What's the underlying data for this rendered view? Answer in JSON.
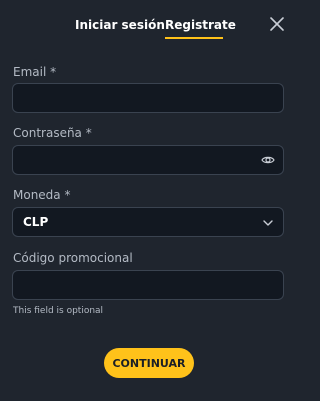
{
  "tabs": {
    "login_label": "Iniciar sesión",
    "register_label": "Registrate",
    "active": "register"
  },
  "colors": {
    "accent": "#ffc21a",
    "background": "#1f252e",
    "field_background": "#121821",
    "field_border": "#3a4350"
  },
  "form": {
    "email": {
      "label": "Email *",
      "value": "",
      "placeholder": ""
    },
    "password": {
      "label": "Contraseña *",
      "value": "",
      "placeholder": "",
      "icon": "eye-icon"
    },
    "currency": {
      "label": "Moneda *",
      "value": "CLP",
      "icon": "chevron-down-icon"
    },
    "promo": {
      "label": "Código promocional",
      "value": "",
      "placeholder": "",
      "hint": "This field is optional"
    }
  },
  "actions": {
    "continue_label": "CONTINUAR"
  },
  "icons": {
    "close": "close-icon"
  }
}
